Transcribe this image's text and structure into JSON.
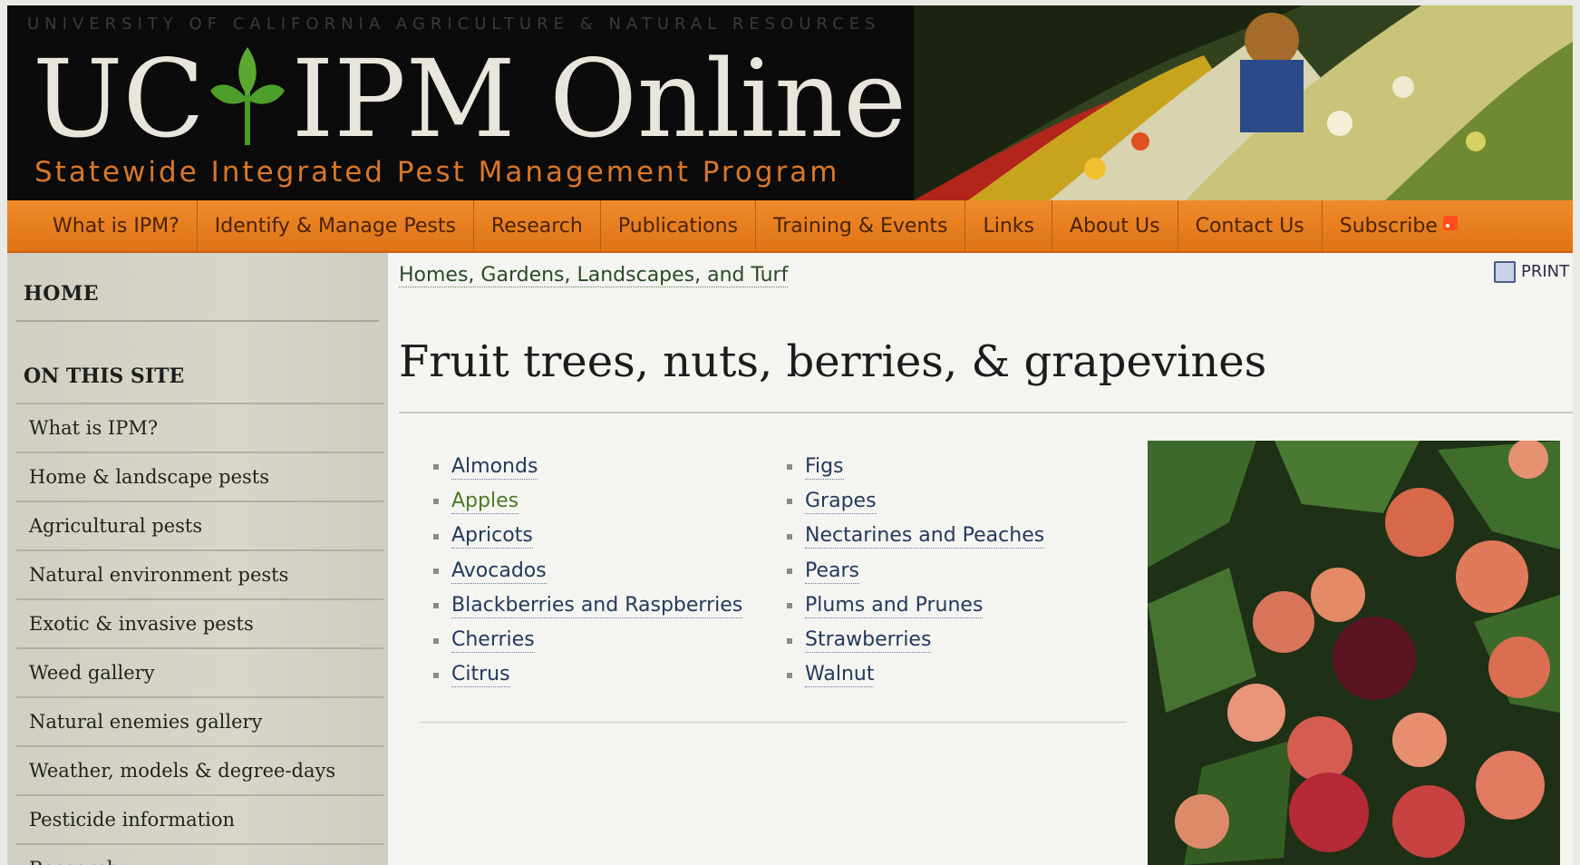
{
  "header": {
    "university": "UNIVERSITY OF CALIFORNIA AGRICULTURE & NATURAL RESOURCES",
    "logo_left": "UC",
    "logo_right": "IPM Online",
    "tagline": "Statewide Integrated Pest Management Program"
  },
  "nav": {
    "items": [
      "What is IPM?",
      "Identify & Manage Pests",
      "Research",
      "Publications",
      "Training & Events",
      "Links",
      "About Us",
      "Contact Us",
      "Subscribe"
    ]
  },
  "sidebar": {
    "home": "HOME",
    "heading": "ON THIS SITE",
    "items": [
      "What is IPM?",
      "Home & landscape pests",
      "Agricultural pests",
      "Natural environment pests",
      "Exotic & invasive pests",
      "Weed gallery",
      "Natural enemies gallery",
      "Weather, models & degree-days",
      "Pesticide information",
      "Research"
    ]
  },
  "main": {
    "breadcrumb": "Homes, Gardens, Landscapes, and Turf",
    "print_label": "PRINT",
    "title": "Fruit trees, nuts, berries, & grapevines",
    "left_links": [
      "Almonds",
      "Apples",
      "Apricots",
      "Avocados",
      "Blackberries and Raspberries",
      "Cherries",
      "Citrus"
    ],
    "right_links": [
      "Figs",
      "Grapes",
      "Nectarines and Peaches",
      "Pears",
      "Plums and Prunes",
      "Strawberries",
      "Walnut"
    ]
  },
  "colors": {
    "nav_orange": "#e87e20",
    "tagline_orange": "#d9772a",
    "link_blue": "#23395d",
    "visited_green": "#4a7a22",
    "sidebar_bg": "#d4d2c7"
  },
  "icons": [
    "leaf-logo-icon",
    "rss-icon",
    "print-icon",
    "bullet-icon"
  ]
}
